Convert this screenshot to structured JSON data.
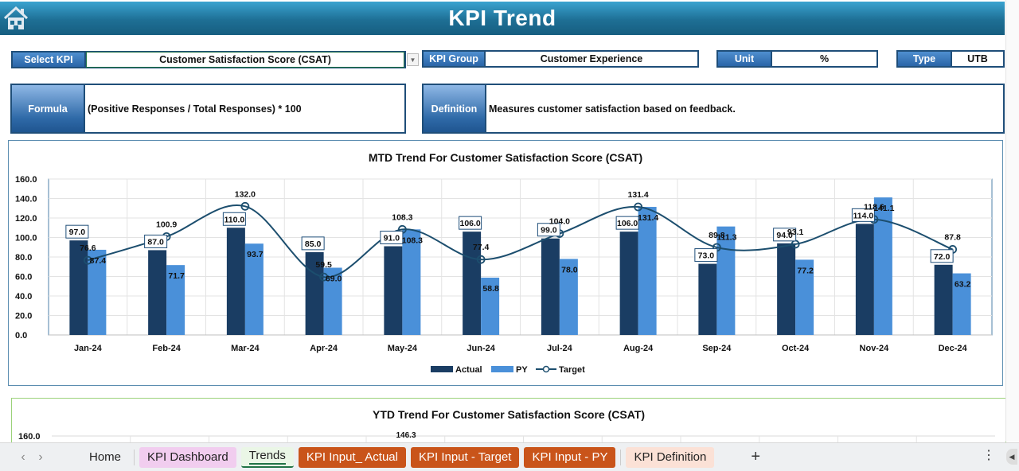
{
  "header": {
    "title": "KPI Trend",
    "home_icon": "home-icon"
  },
  "fields": {
    "select_kpi": {
      "label": "Select KPI",
      "value": "Customer Satisfaction Score (CSAT)"
    },
    "kpi_group": {
      "label": "KPI Group",
      "value": "Customer Experience"
    },
    "unit": {
      "label": "Unit",
      "value": "%"
    },
    "type": {
      "label": "Type",
      "value": "UTB"
    },
    "formula": {
      "label": "Formula",
      "value": "(Positive Responses / Total Responses) * 100"
    },
    "definition": {
      "label": "Definition",
      "value": "Measures customer satisfaction based on feedback."
    }
  },
  "colors": {
    "actual": "#1a3d63",
    "py": "#4a90d9",
    "target": "#1c4e6e",
    "header": "#1e6f95"
  },
  "chart_data": [
    {
      "type": "bar",
      "title": "MTD Trend For Customer Satisfaction Score (CSAT)",
      "xlabel": "",
      "ylabel": "",
      "ylim": [
        0,
        160
      ],
      "yticks": [
        "0.0",
        "20.0",
        "40.0",
        "60.0",
        "80.0",
        "100.0",
        "120.0",
        "140.0",
        "160.0"
      ],
      "grid": true,
      "legend": "bottom",
      "categories": [
        "Jan-24",
        "Feb-24",
        "Mar-24",
        "Apr-24",
        "May-24",
        "Jun-24",
        "Jul-24",
        "Aug-24",
        "Sep-24",
        "Oct-24",
        "Nov-24",
        "Dec-24"
      ],
      "series": [
        {
          "name": "Actual",
          "kind": "bar",
          "values": [
            97.0,
            87.0,
            110.0,
            85.0,
            91.0,
            106.0,
            99.0,
            106.0,
            73.0,
            94.0,
            114.0,
            72.0
          ]
        },
        {
          "name": "PY",
          "kind": "bar",
          "values": [
            87.4,
            71.7,
            93.7,
            69.0,
            108.3,
            58.8,
            78.0,
            131.4,
            111.3,
            77.2,
            141.1,
            63.2
          ]
        },
        {
          "name": "Target",
          "kind": "line",
          "values": [
            76.6,
            100.9,
            132.0,
            59.5,
            108.3,
            77.4,
            104.0,
            131.4,
            89.8,
            93.1,
            118.6,
            87.8
          ]
        }
      ]
    },
    {
      "type": "bar",
      "title": "YTD Trend For Customer Satisfaction Score (CSAT)",
      "ylim_top_label": "160.0",
      "visible_data_labels": [
        "146.3"
      ]
    }
  ],
  "sheet_tabs": [
    {
      "label": "Home",
      "style": "home"
    },
    {
      "label": "KPI Dashboard",
      "style": "pink"
    },
    {
      "label": "Trends",
      "style": "active"
    },
    {
      "label": "KPI Input_ Actual",
      "style": "orange"
    },
    {
      "label": "KPI Input - Target",
      "style": "orange"
    },
    {
      "label": "KPI Input - PY",
      "style": "orange"
    },
    {
      "label": "KPI Definition",
      "style": "peach"
    }
  ],
  "tabbar": {
    "prev": "‹",
    "next": "›",
    "add": "+",
    "more": "⋮"
  }
}
